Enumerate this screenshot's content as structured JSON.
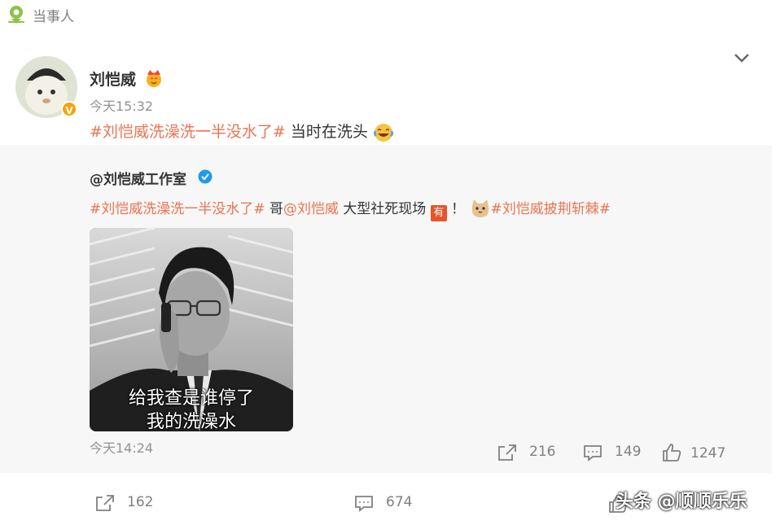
{
  "location": {
    "label": "当事人",
    "icon": "location-pin-icon"
  },
  "post": {
    "author": "刘恺威",
    "time": "今天15:32",
    "topic": "#刘恺威洗澡洗一半没水了#",
    "text": " 当时在洗头",
    "emoji": "laugh-cry-emoji",
    "badge_letter": "V"
  },
  "repost": {
    "author": "@刘恺威工作室",
    "topic1": "#刘恺威洗澡洗一半没水了#",
    "text_a": " 哥",
    "mention": "@刘恺威",
    "text_b": " 大型社死现场",
    "you_label": "有",
    "exclaim": "！",
    "topic2": "#刘恺威披荆斩棘#",
    "image_caption_line1": "给我查是谁停了",
    "image_caption_line2": "我的洗澡水",
    "time": "今天14:24",
    "share_count": "216",
    "comment_count": "149",
    "like_count": "1247"
  },
  "footer": {
    "share_count": "162",
    "comment_count": "674",
    "like_count": "",
    "watermark": "头条 @顺顺乐乐"
  },
  "colors": {
    "topic": "#eb7350",
    "muted": "#939393",
    "repost_bg": "#f7f7f7",
    "badge": "#f6a209"
  }
}
